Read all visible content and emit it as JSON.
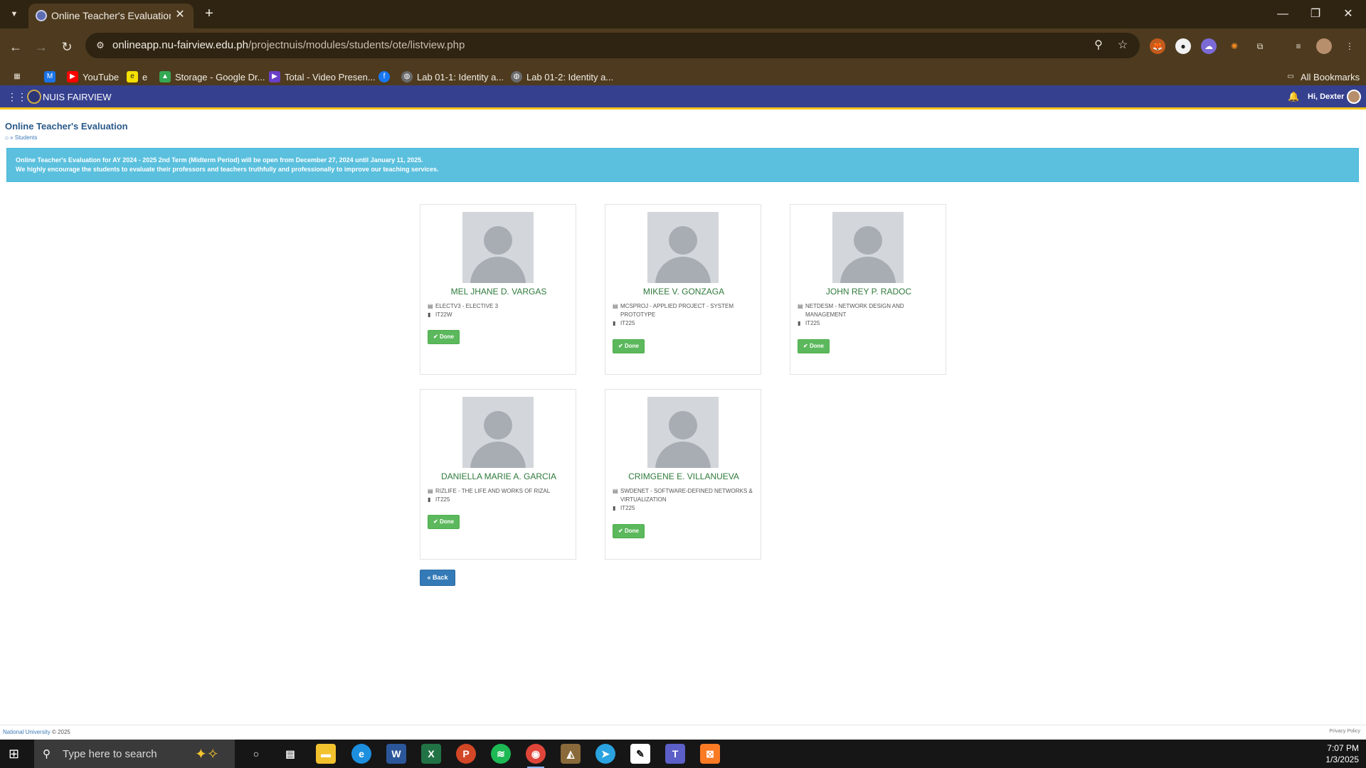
{
  "browser": {
    "tab_title": "Online Teacher's Evaluation | NU",
    "url_host": "onlineapp.nu-fairview.edu.ph",
    "url_path": "/projectnuis/modules/students/ote/listview.php",
    "bookmarks": [
      {
        "label": "",
        "icon": "gmail-icon"
      },
      {
        "label": "YouTube",
        "icon": "youtube-icon"
      },
      {
        "label": "e",
        "icon": "bookmark-e-icon"
      },
      {
        "label": "Storage - Google Dr...",
        "icon": "google-drive-icon"
      },
      {
        "label": "Total - Video Presen...",
        "icon": "video-icon"
      },
      {
        "label": "",
        "icon": "facebook-icon"
      },
      {
        "label": "Lab 01-1: Identity a...",
        "icon": "globe-icon"
      },
      {
        "label": "Lab 01-2: Identity a...",
        "icon": "globe-icon"
      }
    ],
    "all_bookmarks": "All Bookmarks"
  },
  "app": {
    "brand": "NUIS FAIRVIEW",
    "greeting": "Hi, Dexter",
    "page_title": "Online Teacher's Evaluation",
    "breadcrumb": "» Students",
    "alert_line1": "Online Teacher's Evaluation for AY 2024 - 2025 2nd Term (Midterm Period) will be open from December 27, 2024 until January 11, 2025.",
    "alert_line2": "We highly encourage the students to evaluate their professors and teachers truthfully and professionally to improve our teaching services.",
    "done_label": "Done",
    "back_label": "Back"
  },
  "teachers": [
    {
      "name": "MEL JHANE D. VARGAS",
      "subject": "ELECTV3 - ELECTIVE 3",
      "section": "IT22W",
      "status": "Done"
    },
    {
      "name": "MIKEE V. GONZAGA",
      "subject": "MCSPROJ - APPLIED PROJECT - SYSTEM PROTOTYPE",
      "section": "IT225",
      "status": "Done"
    },
    {
      "name": "JOHN REY P. RADOC",
      "subject": "NETDESM - NETWORK DESIGN AND MANAGEMENT",
      "section": "IT225",
      "status": "Done"
    },
    {
      "name": "DANIELLA MARIE A. GARCIA",
      "subject": "RIZLIFE - THE LIFE AND WORKS OF RIZAL",
      "section": "IT225",
      "status": "Done"
    },
    {
      "name": "CRIMGENE E. VILLANUEVA",
      "subject": "SWDENET - SOFTWARE-DEFINED NETWORKS & VIRTUALIZATION",
      "section": "IT225",
      "status": "Done"
    }
  ],
  "footer": {
    "org": "National University",
    "copyright": "© 2025",
    "privacy": "Privacy Policy"
  },
  "taskbar": {
    "search_placeholder": "Type here to search",
    "time": "7:07 PM",
    "date": "1/3/2025"
  }
}
